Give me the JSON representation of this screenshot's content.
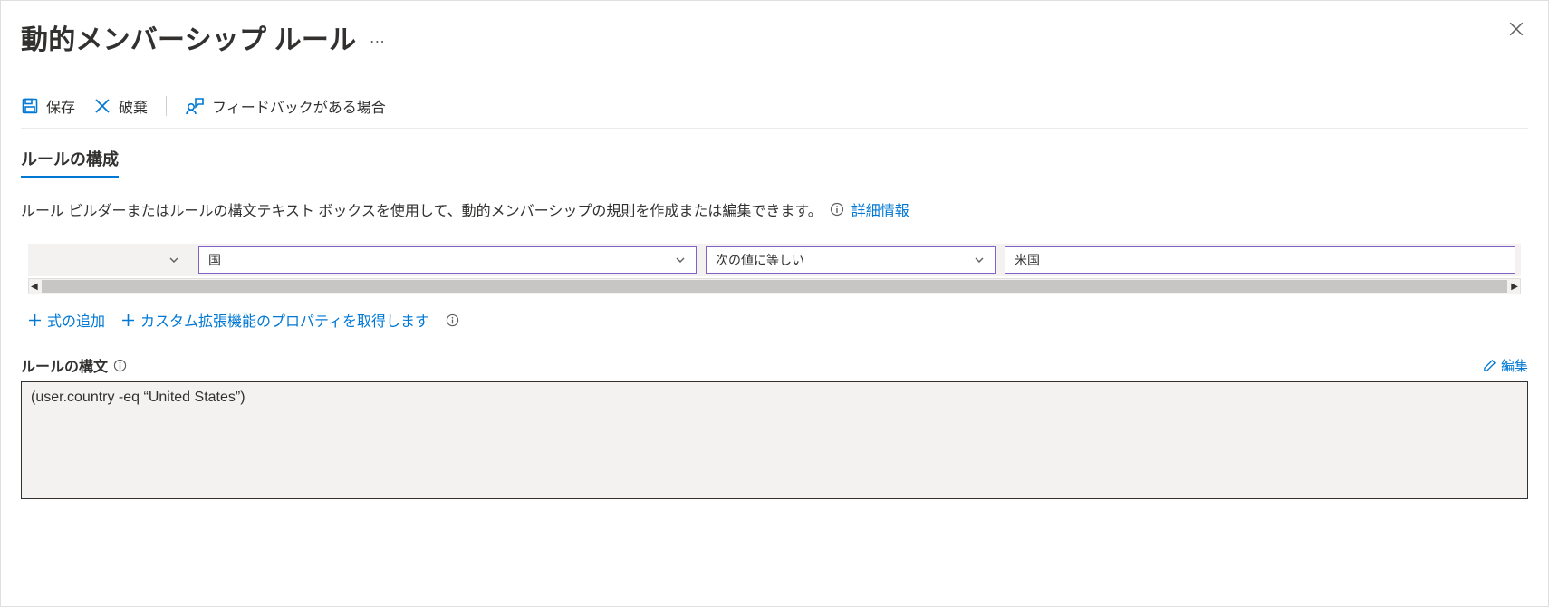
{
  "header": {
    "title": "動的メンバーシップ ルール",
    "more": "…"
  },
  "toolbar": {
    "save": "保存",
    "discard": "破棄",
    "feedback": "フィードバックがある場合"
  },
  "tabs": {
    "configure": "ルールの構成"
  },
  "description": {
    "text": "ルール ビルダーまたはルールの構文テキスト ボックスを使用して、動的メンバーシップの規則を作成または編集できます。",
    "learn_more": "詳細情報"
  },
  "builder": {
    "property": "国",
    "operator": "次の値に等しい",
    "value": "米国"
  },
  "links": {
    "add_expression": "式の追加",
    "get_custom_props": "カスタム拡張機能のプロパティを取得します"
  },
  "syntax": {
    "label": "ルールの構文",
    "edit": "編集",
    "value": "(user.country -eq “United States”)"
  }
}
